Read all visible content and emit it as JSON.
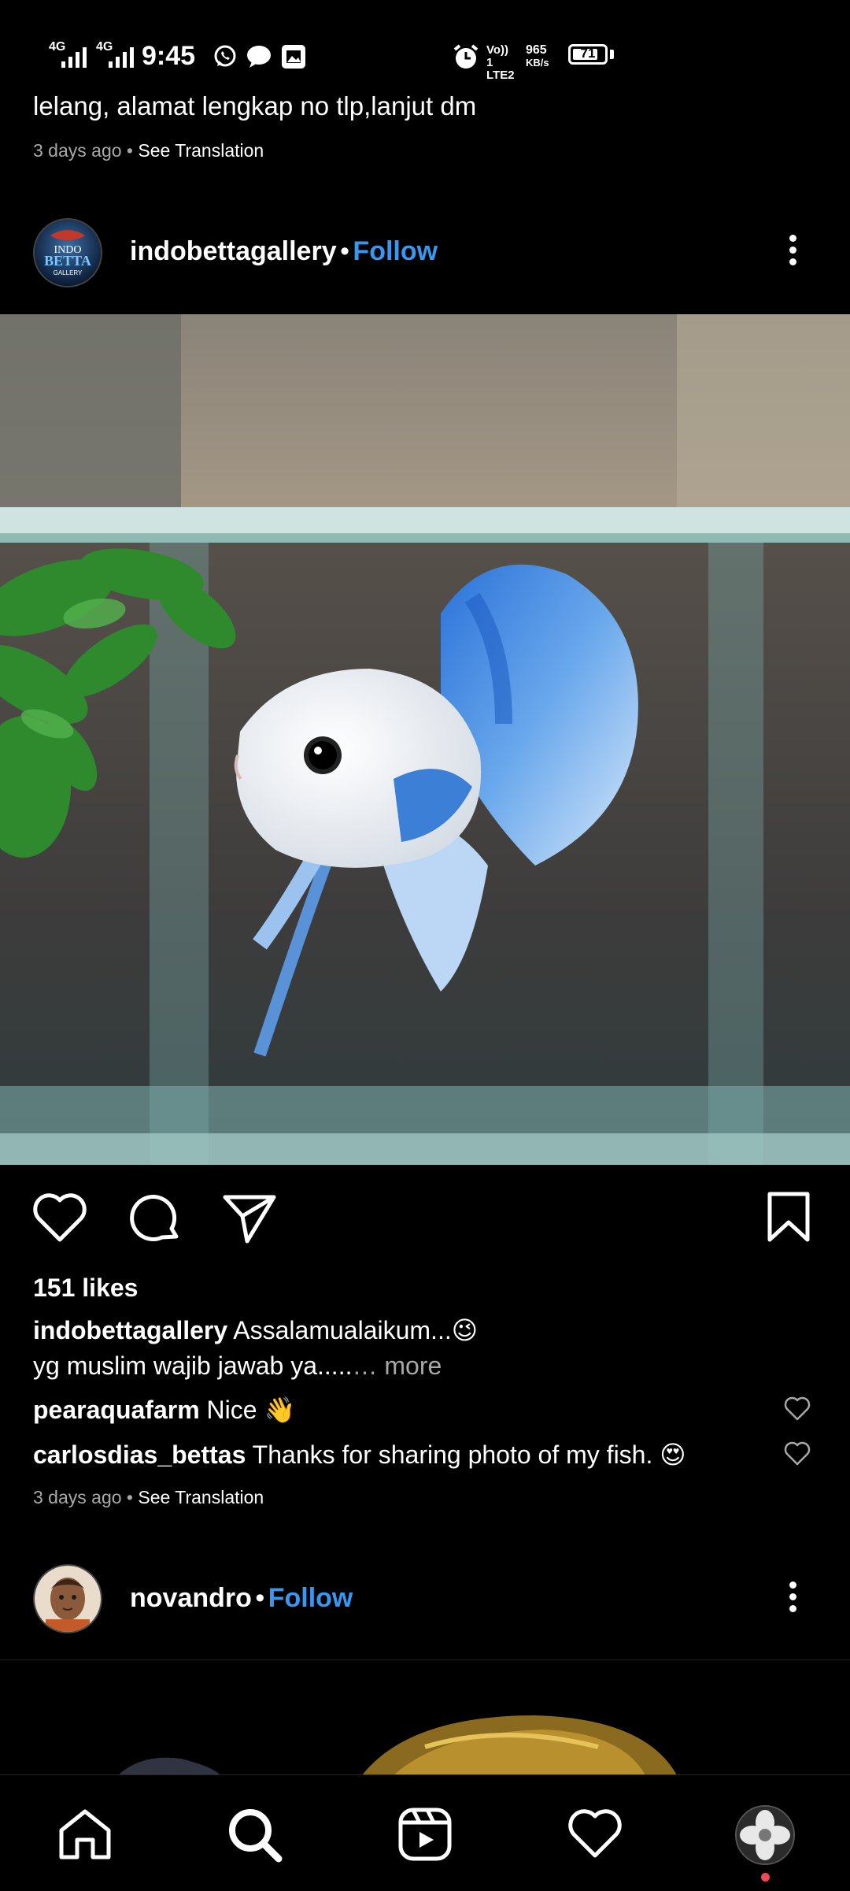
{
  "status_bar": {
    "net1": "4G",
    "net2": "4G",
    "time": "9:45",
    "volte_top": "Vo)) 1",
    "volte_bottom": "LTE2",
    "speed_top": "965",
    "speed_bottom": "KB/s",
    "battery": "71",
    "icons": [
      "whatsapp-icon",
      "message-bubble-icon",
      "gallery-notification-icon",
      "alarm-icon"
    ]
  },
  "prev_post": {
    "caption_tail": "lelang, alamat lengkap no tlp,lanjut dm",
    "time_ago": "3 days ago",
    "sep": "•",
    "see_translation": "See Translation"
  },
  "post": {
    "username": "indobettagallery",
    "dot": "•",
    "follow": "Follow",
    "avatar_text_1": "INDO",
    "avatar_text_2": "BETTA",
    "avatar_text_3": "GALLERY",
    "likes": "151 likes",
    "caption_user": "indobettagallery",
    "caption_text": "Assalamualaikum...😉",
    "caption_line2": "yg muslim wajib jawab ya.....",
    "more": "… more",
    "comments": [
      {
        "user": "pearaquafarm",
        "text": "Nice 👋"
      },
      {
        "user": "carlosdias_bettas",
        "text": "Thanks for sharing photo of my fish. 😍"
      }
    ],
    "time_ago": "3 days ago",
    "sep": "•",
    "see_translation": "See Translation"
  },
  "next_post": {
    "username": "novandro",
    "dot": "•",
    "follow": "Follow"
  },
  "colors": {
    "background": "#000000",
    "link_blue": "#3897f0",
    "secondary_text": "#a8a8a8",
    "notification_dot": "#ed4956"
  },
  "nav": [
    "home-icon",
    "search-icon",
    "reels-icon",
    "activity-heart-icon",
    "profile-avatar"
  ]
}
